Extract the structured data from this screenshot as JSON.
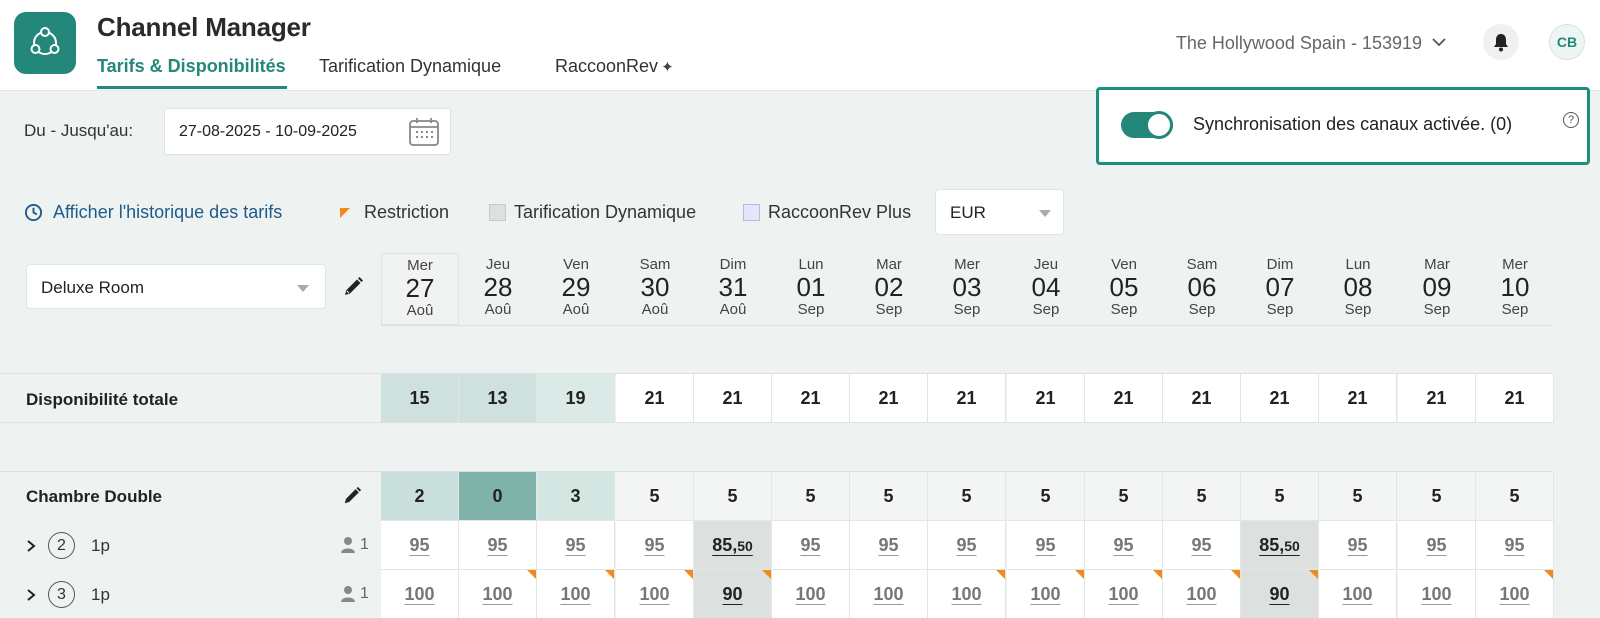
{
  "header": {
    "title": "Channel Manager",
    "tabs": [
      {
        "label": "Tarifs & Disponibilités",
        "active": true
      },
      {
        "label": "Tarification Dynamique",
        "active": false
      },
      {
        "label": "RaccoonRev",
        "active": false
      }
    ],
    "property": "The Hollywood Spain - 153919",
    "avatar_initials": "CB"
  },
  "date_range": {
    "label": "Du - Jusqu'au:",
    "value": "27-08-2025 - 10-09-2025"
  },
  "sync": {
    "text": "Synchronisation des canaux activée. (0)",
    "enabled": true
  },
  "legend": {
    "history_link": "Afficher l'historique des tarifs",
    "restriction": "Restriction",
    "dynamic": "Tarification Dynamique",
    "raccoon_plus": "RaccoonRev Plus",
    "currency": "EUR"
  },
  "room_select": "Deluxe Room",
  "days": [
    {
      "dow": "Mer",
      "num": "27",
      "mon": "Aoû",
      "today": true
    },
    {
      "dow": "Jeu",
      "num": "28",
      "mon": "Aoû"
    },
    {
      "dow": "Ven",
      "num": "29",
      "mon": "Aoû"
    },
    {
      "dow": "Sam",
      "num": "30",
      "mon": "Aoû"
    },
    {
      "dow": "Dim",
      "num": "31",
      "mon": "Aoû"
    },
    {
      "dow": "Lun",
      "num": "01",
      "mon": "Sep"
    },
    {
      "dow": "Mar",
      "num": "02",
      "mon": "Sep"
    },
    {
      "dow": "Mer",
      "num": "03",
      "mon": "Sep"
    },
    {
      "dow": "Jeu",
      "num": "04",
      "mon": "Sep"
    },
    {
      "dow": "Ven",
      "num": "05",
      "mon": "Sep"
    },
    {
      "dow": "Sam",
      "num": "06",
      "mon": "Sep"
    },
    {
      "dow": "Dim",
      "num": "07",
      "mon": "Sep"
    },
    {
      "dow": "Lun",
      "num": "08",
      "mon": "Sep"
    },
    {
      "dow": "Mar",
      "num": "09",
      "mon": "Sep"
    },
    {
      "dow": "Mer",
      "num": "10",
      "mon": "Sep"
    }
  ],
  "total_availability": {
    "label": "Disponibilité totale",
    "values": [
      "15",
      "13",
      "19",
      "21",
      "21",
      "21",
      "21",
      "21",
      "21",
      "21",
      "21",
      "21",
      "21",
      "21",
      "21"
    ],
    "shades": [
      "#cfe1de",
      "#cfe1de",
      "#dbe9e7",
      "",
      "",
      "",
      "",
      "",
      "",
      "",
      "",
      "",
      "",
      "",
      ""
    ]
  },
  "room_type": {
    "label": "Chambre Double",
    "values": [
      "2",
      "0",
      "3",
      "5",
      "5",
      "5",
      "5",
      "5",
      "5",
      "5",
      "5",
      "5",
      "5",
      "5",
      "5"
    ],
    "shades": [
      "#c9dfdb",
      "#7fb3aa",
      "#d3e6e2",
      "#f3f5f5",
      "#f3f5f5",
      "#f3f5f5",
      "#f3f5f5",
      "#f3f5f5",
      "#f3f5f5",
      "#f3f5f5",
      "#f3f5f5",
      "#f3f5f5",
      "#f3f5f5",
      "#f3f5f5",
      "#f3f5f5"
    ]
  },
  "rate_rows": [
    {
      "plan": "2",
      "label": "1p",
      "occupancy": "1",
      "rates": [
        {
          "main": "95"
        },
        {
          "main": "95"
        },
        {
          "main": "95"
        },
        {
          "main": "95"
        },
        {
          "main": "85,",
          "dec": "50",
          "dynamic": true
        },
        {
          "main": "95"
        },
        {
          "main": "95"
        },
        {
          "main": "95"
        },
        {
          "main": "95"
        },
        {
          "main": "95"
        },
        {
          "main": "95"
        },
        {
          "main": "85,",
          "dec": "50",
          "dynamic": true
        },
        {
          "main": "95"
        },
        {
          "main": "95"
        },
        {
          "main": "95"
        }
      ]
    },
    {
      "plan": "3",
      "label": "1p",
      "occupancy": "1",
      "rates": [
        {
          "main": "100"
        },
        {
          "main": "100",
          "restriction": true
        },
        {
          "main": "100",
          "restriction": true
        },
        {
          "main": "100",
          "restriction": true
        },
        {
          "main": "90",
          "dynamic": true,
          "restriction": true
        },
        {
          "main": "100"
        },
        {
          "main": "100"
        },
        {
          "main": "100",
          "restriction": true
        },
        {
          "main": "100",
          "restriction": true
        },
        {
          "main": "100",
          "restriction": true
        },
        {
          "main": "100",
          "restriction": true
        },
        {
          "main": "90",
          "dynamic": true,
          "restriction": true
        },
        {
          "main": "100"
        },
        {
          "main": "100"
        },
        {
          "main": "100",
          "restriction": true
        }
      ]
    }
  ],
  "colors": {
    "accent": "#23877a",
    "restriction": "#f08a1c",
    "link": "#1e5a8a"
  }
}
